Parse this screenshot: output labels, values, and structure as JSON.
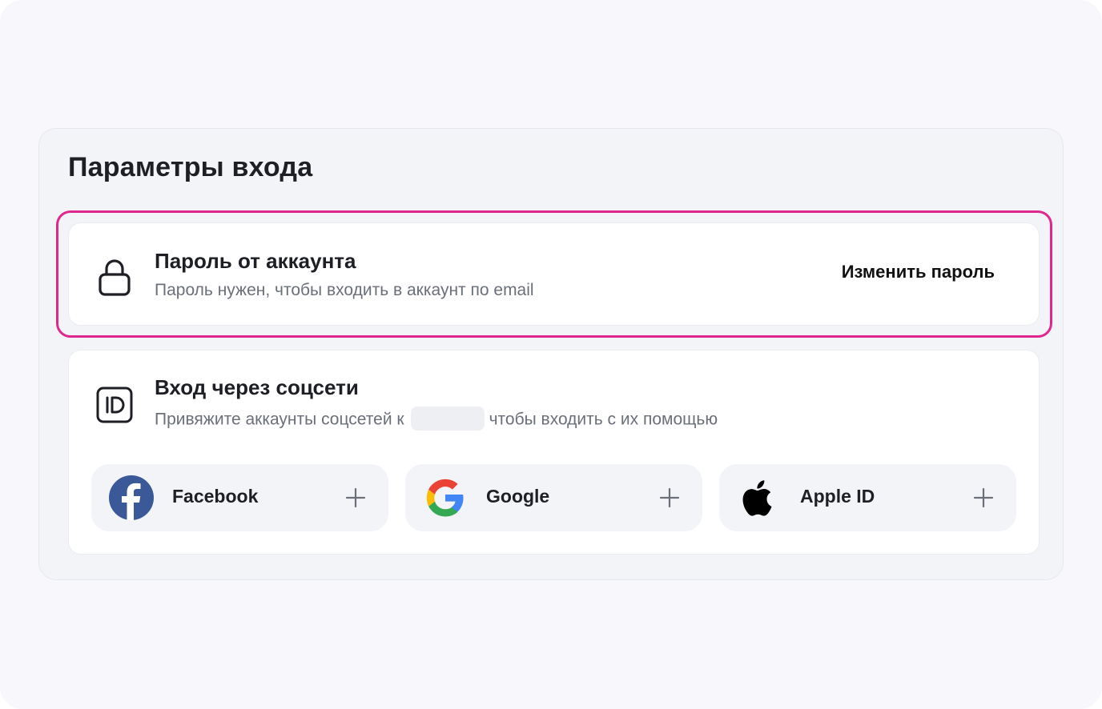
{
  "settings": {
    "title": "Параметры входа",
    "password": {
      "title": "Пароль от аккаунта",
      "subtitle": "Пароль нужен, чтобы входить в аккаунт по email",
      "action": "Изменить пароль",
      "icon": "lock-icon"
    },
    "social": {
      "title": "Вход через соцсети",
      "subtitle_before": "Привяжите аккаунты соцсетей к",
      "subtitle_after": "чтобы входить с их помощью",
      "icon": "id-icon",
      "providers": [
        {
          "name": "Facebook",
          "icon": "facebook-icon",
          "action_icon": "plus-icon"
        },
        {
          "name": "Google",
          "icon": "google-icon",
          "action_icon": "plus-icon"
        },
        {
          "name": "Apple ID",
          "icon": "apple-icon",
          "action_icon": "plus-icon"
        }
      ]
    }
  },
  "colors": {
    "highlight": "#e0278f",
    "facebook": "#3b5998",
    "text_primary": "#1d1f24",
    "text_secondary": "#6b6f7a"
  }
}
